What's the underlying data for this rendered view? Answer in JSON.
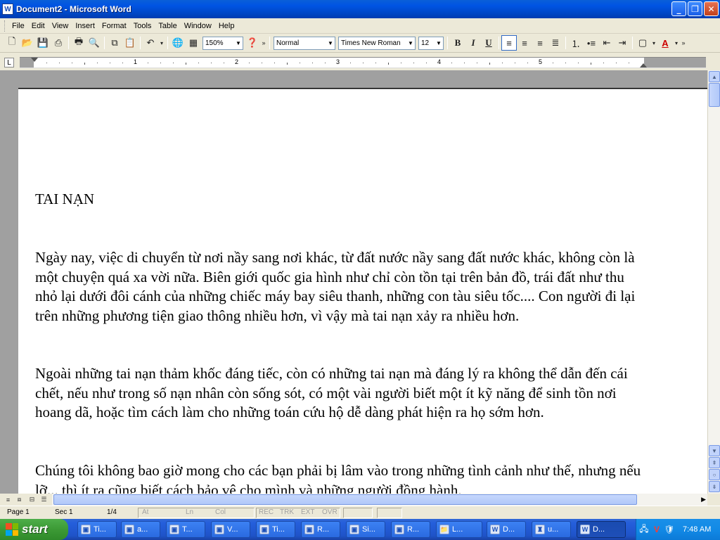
{
  "window": {
    "title": "Document2 - Microsoft Word",
    "icon": "W"
  },
  "menu": [
    "File",
    "Edit",
    "View",
    "Insert",
    "Format",
    "Tools",
    "Table",
    "Window",
    "Help"
  ],
  "toolbar": {
    "zoom": "150%",
    "style": "Normal",
    "font": "Times New Roman",
    "size": "12",
    "bold": "B",
    "italic": "I",
    "underline": "U"
  },
  "ruler": {
    "numbers": [
      "1",
      "2",
      "3",
      "4",
      "5"
    ]
  },
  "document": {
    "title": "TAI NẠN",
    "paragraphs": [
      "Ngày nay, việc di chuyển từ nơi nầy sang nơi khác, từ đất nước nầy sang đất nước khác, không còn là một chuyện quá xa vời nữa. Biên giới quốc gia hình như chỉ còn tồn tại trên bản đồ, trái đất như thu nhỏ lại dưới đôi cánh của những chiếc máy bay siêu thanh, những con tàu siêu tốc.... Con người đi lại trên những phương tiện giao thông nhiều hơn, vì vậy mà tai nạn xảy ra nhiều hơn.",
      "Ngoài những tai nạn thảm khốc đáng tiếc, còn có những tai nạn mà đáng lý ra không thể dẫn đến cái chết, nếu như trong số nạn nhân còn sống sót, có một vài người biết một ít kỹ năng để sinh tồn nơi hoang dã, hoặc tìm cách làm cho những toán cứu hộ dễ dàng phát hiện ra họ sớm hơn.",
      "Chúng tôi không bao giờ mong cho các bạn phải bị lâm vào trong những tình cảnh như thế, nhưng nếu lỡ... thì ít ra cũng biết cách bảo vệ cho mình và những người đồng hành."
    ]
  },
  "status": {
    "page": "Page 1",
    "sec": "Sec 1",
    "pages": "1/4",
    "at": "At",
    "ln": "Ln",
    "col": "Col",
    "rec": "REC",
    "trk": "TRK",
    "ext": "EXT",
    "ovr": "OVR"
  },
  "taskbar": {
    "start": "start",
    "tasks": [
      "Ti...",
      "a...",
      "T...",
      "V...",
      "Ti...",
      "R...",
      "Si...",
      "R...",
      "L...",
      "D...",
      "u...",
      "D..."
    ],
    "clock": "7:48 AM"
  }
}
